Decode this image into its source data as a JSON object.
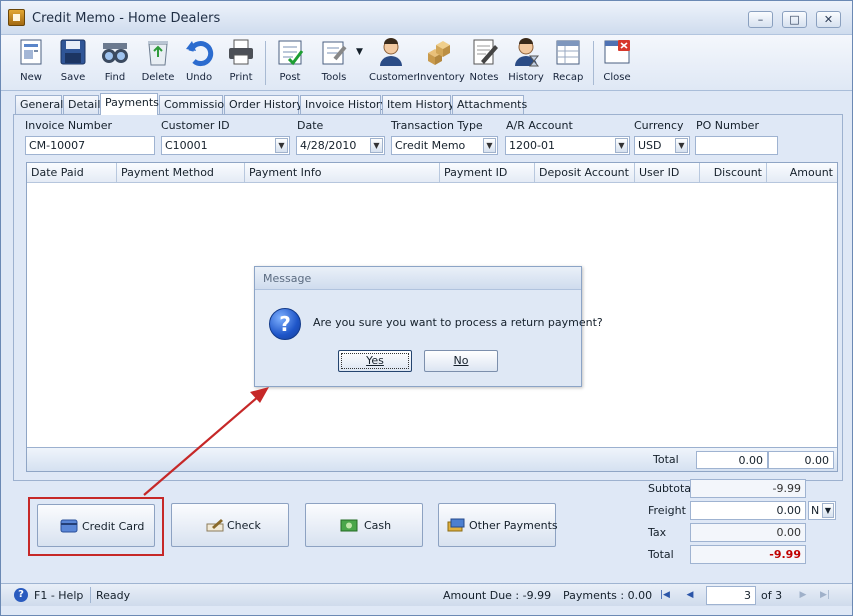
{
  "window": {
    "title": "Credit Memo - Home Dealers",
    "minimize": "–",
    "maximize": "□",
    "close": "✕"
  },
  "toolbar": [
    {
      "label": "New",
      "icon": "new-document-icon"
    },
    {
      "label": "Save",
      "icon": "save-disk-icon"
    },
    {
      "label": "Find",
      "icon": "binoculars-icon"
    },
    {
      "label": "Delete",
      "icon": "recycle-bin-icon"
    },
    {
      "label": "Undo",
      "icon": "undo-arrow-icon"
    },
    {
      "label": "Print",
      "icon": "printer-icon"
    },
    {
      "label": "Post",
      "icon": "post-ledger-icon"
    },
    {
      "label": "Tools",
      "icon": "tools-icon"
    },
    {
      "label": "Customer",
      "icon": "customer-person-icon"
    },
    {
      "label": "Inventory",
      "icon": "inventory-boxes-icon"
    },
    {
      "label": "Notes",
      "icon": "notes-pencil-icon"
    },
    {
      "label": "History",
      "icon": "history-person-icon"
    },
    {
      "label": "Recap",
      "icon": "recap-sheet-icon"
    },
    {
      "label": "Close",
      "icon": "close-window-icon"
    }
  ],
  "tabs": [
    "General",
    "Detail",
    "Payments",
    "Commission",
    "Order History",
    "Invoice History",
    "Item History",
    "Attachments"
  ],
  "form": {
    "invoice_number_label": "Invoice Number",
    "invoice_number": "CM-10007",
    "customer_id_label": "Customer ID",
    "customer_id": "C10001",
    "date_label": "Date",
    "date": "4/28/2010",
    "transaction_type_label": "Transaction Type",
    "transaction_type": "Credit Memo",
    "ar_account_label": "A/R Account",
    "ar_account": "1200-01",
    "currency_label": "Currency",
    "currency": "USD",
    "po_number_label": "PO Number",
    "po_number": ""
  },
  "grid": {
    "columns": [
      "Date Paid",
      "Payment Method",
      "Payment Info",
      "Payment ID",
      "Deposit Account",
      "User ID",
      "Discount",
      "Amount"
    ],
    "total_label": "Total",
    "total_discount": "0.00",
    "total_amount": "0.00"
  },
  "dialog": {
    "title": "Message",
    "message": "Are you sure you want to process a return payment?",
    "yes": "Yes",
    "no": "No",
    "icon": "question-icon"
  },
  "payment_buttons": {
    "credit_card": "Credit Card",
    "check": "Check",
    "cash": "Cash",
    "other": "Other Payments"
  },
  "totals": {
    "subtotal_label": "Subtotal",
    "subtotal": "-9.99",
    "freight_label": "Freight",
    "freight": "0.00",
    "freight_code": "N",
    "tax_label": "Tax",
    "tax": "0.00",
    "total_label": "Total",
    "total": "-9.99"
  },
  "status": {
    "help": "F1 - Help",
    "state": "Ready",
    "amount_due": "Amount Due : -9.99",
    "payments": "Payments : 0.00",
    "page": "3",
    "of": "of 3"
  },
  "colors": {
    "highlight": "#c62828",
    "total_negative": "#c00000",
    "accent": "#1e55c8"
  }
}
